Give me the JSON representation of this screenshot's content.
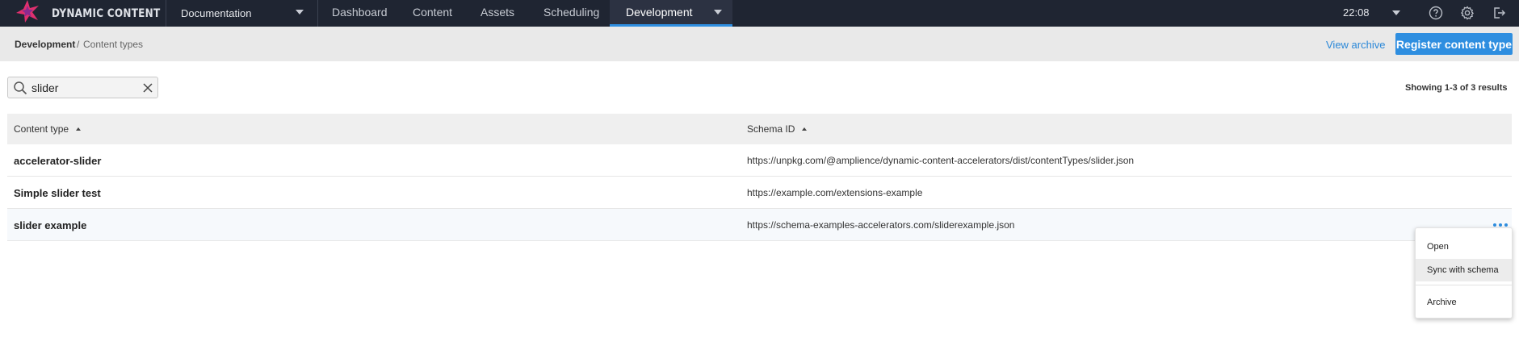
{
  "app": {
    "brand": "DYNAMIC CONTENT",
    "hub": "Documentation",
    "nav": [
      "Dashboard",
      "Content",
      "Assets",
      "Scheduling",
      "Development"
    ],
    "active_nav": "Development",
    "time": "22:08",
    "icons": [
      "help-icon",
      "gear-icon",
      "sign-out-icon"
    ]
  },
  "breadcrumb": {
    "root": "Development",
    "separator": "/",
    "leaf": "Content types"
  },
  "actions": {
    "view_archive": "View archive",
    "register": "Register content type"
  },
  "search": {
    "value": "slider",
    "placeholder": ""
  },
  "results_text": "Showing 1-3 of 3 results",
  "table": {
    "headers": [
      "Content type",
      "Schema ID"
    ],
    "rows": [
      {
        "name": "accelerator-slider",
        "schema": "https://unpkg.com/@amplience/dynamic-content-accelerators/dist/contentTypes/slider.json"
      },
      {
        "name": "Simple slider test",
        "schema": "https://example.com/extensions-example"
      },
      {
        "name": "slider example",
        "schema": "https://schema-examples-accelerators.com/sliderexample.json"
      }
    ]
  },
  "context_menu": {
    "items": [
      "Open",
      "Sync with schema",
      "Archive"
    ]
  },
  "colors": {
    "nav_bg": "#1f2532",
    "accent": "#2e8ee0",
    "subbar_bg": "#e9e9e9",
    "brand_pink": "#e0306e"
  }
}
